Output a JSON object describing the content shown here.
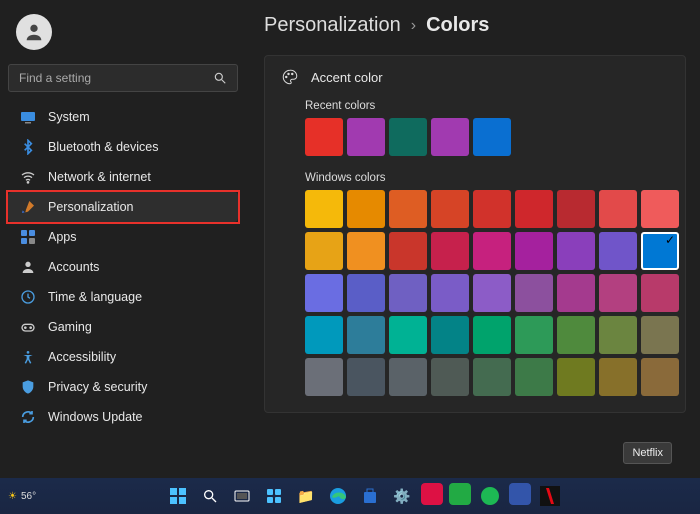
{
  "profile": {
    "name": "",
    "email": ""
  },
  "search": {
    "placeholder": "Find a setting"
  },
  "sidebar": {
    "items": [
      {
        "label": "System"
      },
      {
        "label": "Bluetooth & devices"
      },
      {
        "label": "Network & internet"
      },
      {
        "label": "Personalization"
      },
      {
        "label": "Apps"
      },
      {
        "label": "Accounts"
      },
      {
        "label": "Time & language"
      },
      {
        "label": "Gaming"
      },
      {
        "label": "Accessibility"
      },
      {
        "label": "Privacy & security"
      },
      {
        "label": "Windows Update"
      }
    ]
  },
  "breadcrumb": {
    "parent": "Personalization",
    "current": "Colors"
  },
  "panel": {
    "title": "Accent color",
    "recent_label": "Recent colors",
    "windows_label": "Windows colors"
  },
  "recent_colors": [
    "#e63028",
    "#a13ab0",
    "#0f6b5e",
    "#a13ab0",
    "#0a6fd1"
  ],
  "windows_colors": [
    "#f5b90a",
    "#e68a00",
    "#de5d23",
    "#d64426",
    "#d1322b",
    "#cf272c",
    "#b82a30",
    "#e24a4a",
    "#ef5b5b",
    "#e7a316",
    "#f09020",
    "#c9362b",
    "#c6214c",
    "#c6217e",
    "#a5219e",
    "#8a3fbb",
    "#7055c9",
    "#0078d4",
    "#6a6de2",
    "#5a5ec7",
    "#6f60c2",
    "#7a5cc7",
    "#8c5cc7",
    "#8c509e",
    "#a43a8e",
    "#b34080",
    "#b83a6a",
    "#0099bc",
    "#2d7d9a",
    "#00b294",
    "#038387",
    "#00a36c",
    "#2d9a58",
    "#4f8a3d",
    "#6b8540",
    "#7a7550",
    "#6b6f78",
    "#4a5560",
    "#5a6268",
    "#4f5a55",
    "#446b50",
    "#3d7a48",
    "#6f7a20",
    "#87702a",
    "#8a6a3a"
  ],
  "selected_index": 17,
  "tooltip": "Netflix",
  "taskbar": {
    "temp": "56°"
  }
}
